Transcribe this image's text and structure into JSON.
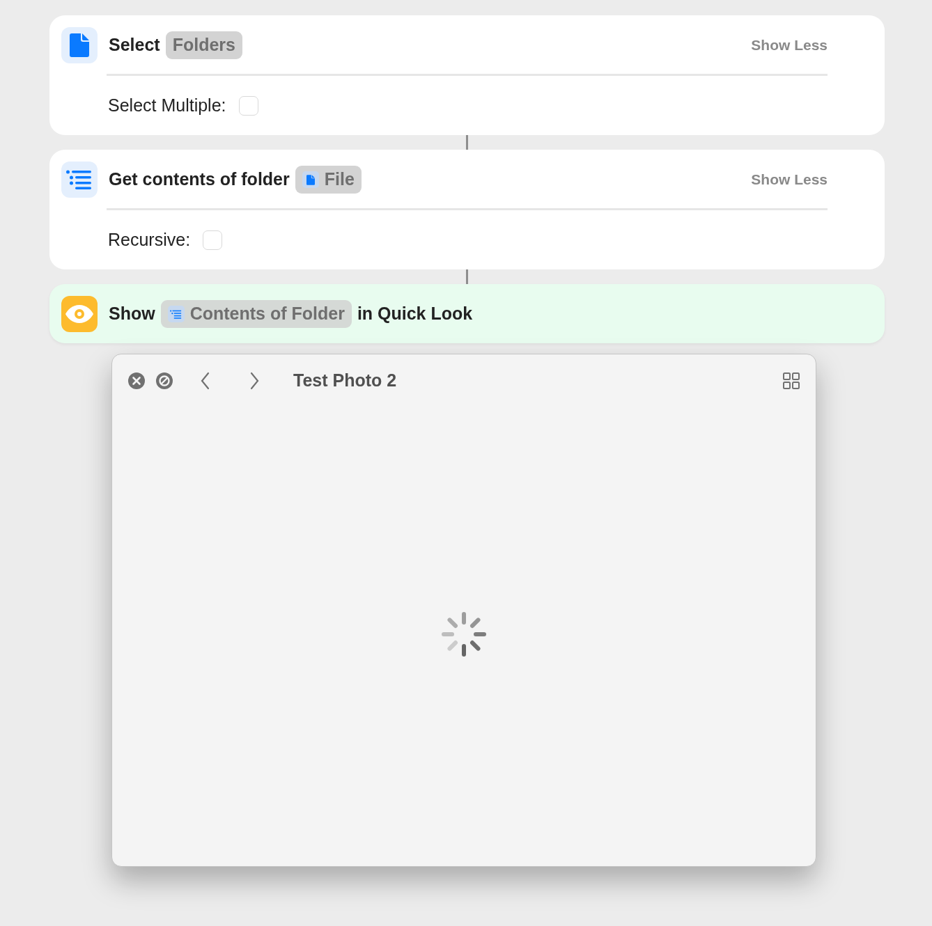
{
  "actions": [
    {
      "kind": "file",
      "parts": [
        {
          "kind": "text",
          "text": "Select"
        },
        {
          "kind": "token",
          "text": "Folders"
        }
      ],
      "toggle": "Show Less",
      "options": [
        {
          "label": "Select Multiple:",
          "checked": false
        }
      ]
    },
    {
      "kind": "list",
      "parts": [
        {
          "kind": "text",
          "text": "Get contents of folder"
        },
        {
          "kind": "file_token",
          "text": "File"
        }
      ],
      "toggle": "Show Less",
      "options": [
        {
          "label": "Recursive:",
          "checked": false
        }
      ]
    },
    {
      "kind": "preview",
      "parts": [
        {
          "kind": "text",
          "text": "Show"
        },
        {
          "kind": "list_token",
          "text": "Contents of Folder"
        },
        {
          "kind": "text",
          "text": "in Quick Look"
        }
      ]
    }
  ],
  "quick_look": {
    "title": "Test Photo 2",
    "loading": true
  }
}
